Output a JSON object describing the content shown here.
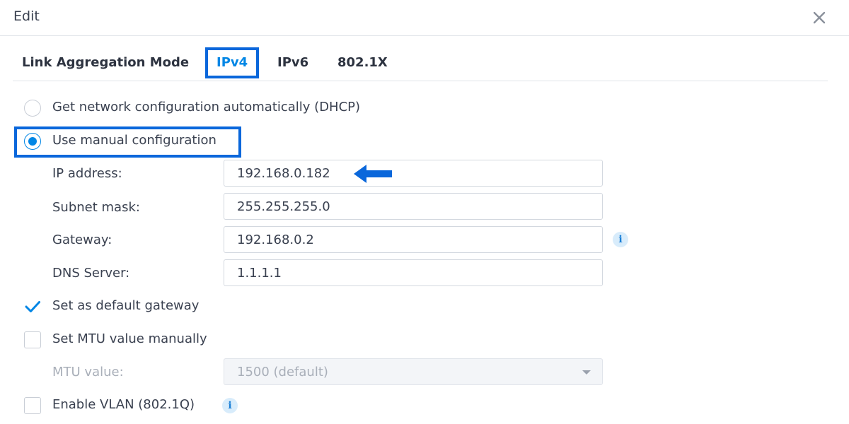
{
  "window": {
    "title": "Edit",
    "close_icon": "close-icon"
  },
  "tabs": [
    {
      "label": "Link Aggregation Mode",
      "active": false
    },
    {
      "label": "IPv4",
      "active": true
    },
    {
      "label": "IPv6",
      "active": false
    },
    {
      "label": "802.1X",
      "active": false
    }
  ],
  "ip_mode": {
    "dhcp_label": "Get network configuration automatically (DHCP)",
    "dhcp_selected": false,
    "manual_label": "Use manual configuration",
    "manual_selected": true
  },
  "fields": {
    "ip_address": {
      "label": "IP address:",
      "value": "192.168.0.182"
    },
    "subnet_mask": {
      "label": "Subnet mask:",
      "value": "255.255.255.0"
    },
    "gateway": {
      "label": "Gateway:",
      "value": "192.168.0.2",
      "info_icon": "info-icon"
    },
    "dns_server": {
      "label": "DNS Server:",
      "value": "1.1.1.1"
    }
  },
  "options": {
    "default_gateway": {
      "label": "Set as default gateway",
      "checked": true
    },
    "mtu_manual": {
      "label": "Set MTU value manually",
      "checked": false
    },
    "mtu_value": {
      "label": "MTU value:",
      "selected": "1500 (default)",
      "disabled": true
    },
    "vlan": {
      "label": "Enable VLAN (802.1Q)",
      "checked": false,
      "info_icon": "info-icon"
    }
  },
  "colors": {
    "accent": "#0086e5",
    "highlight_box": "#0a67db",
    "text": "#3a4150"
  }
}
